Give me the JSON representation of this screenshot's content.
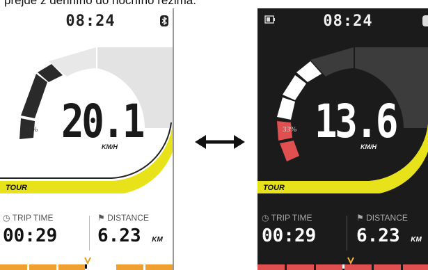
{
  "caption": "prejde z denního do nočního režima:",
  "day": {
    "time": "08:24",
    "speed": "20.1",
    "speed_unit": "KM/H",
    "assist": "33%",
    "mode": "TOUR",
    "trip_time_label": "TRIP TIME",
    "trip_time": "00:29",
    "distance_label": "DISTANCE",
    "distance": "6.23",
    "distance_unit": "KM"
  },
  "night": {
    "time": "08:24",
    "speed": "13.6",
    "speed_unit": "KM/H",
    "assist": "33%",
    "mode": "TOUR",
    "trip_time_label": "TRIP TIME",
    "trip_time": "00:29",
    "distance_label": "DISTANCE",
    "distance": "6.23",
    "distance_unit": "KM"
  },
  "colors": {
    "accent_yellow": "#e8e21a",
    "night_bg": "#1b1b1b",
    "night_segment_active": "#ffffff",
    "night_segment_inactive": "#3c3c3c",
    "day_segment_active": "#2a2a2a",
    "day_segment_inactive": "#e3e3e3",
    "bar_red": "#e05050",
    "bar_orange": "#f0a030"
  },
  "icons": [
    "bluetooth-icon",
    "battery-icon",
    "clock-icon",
    "distance-icon",
    "double-arrow-icon",
    "brand-logo"
  ]
}
